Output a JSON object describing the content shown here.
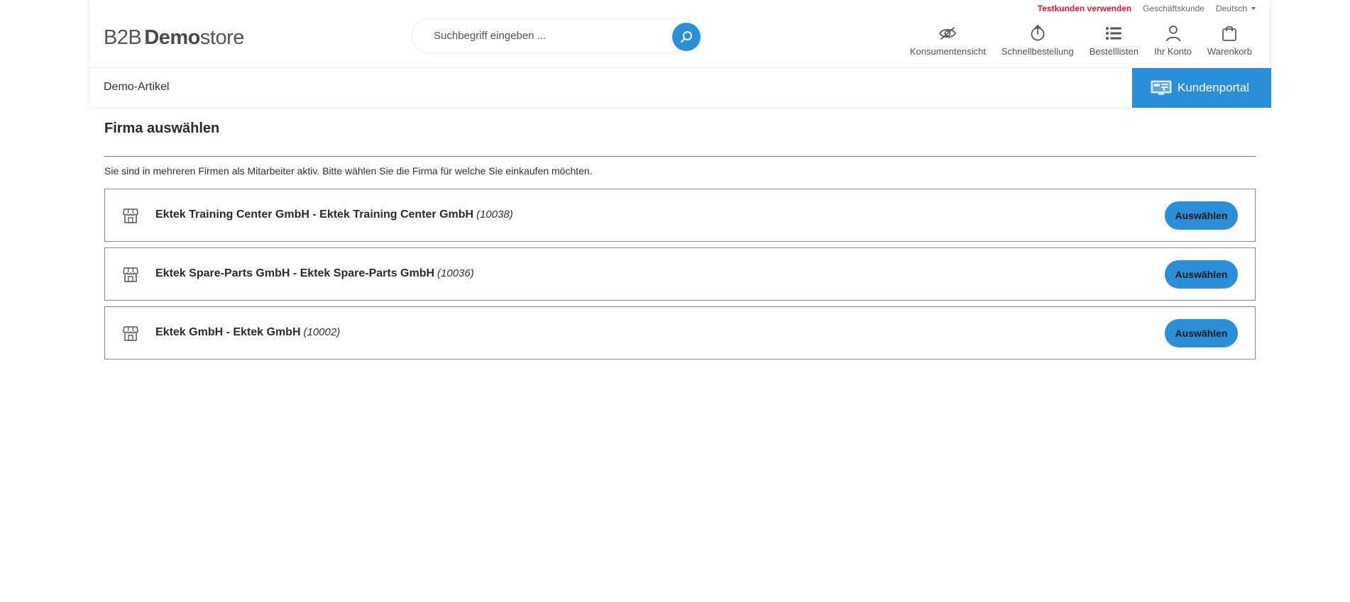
{
  "topbar": {
    "test_customers": "Testkunden verwenden",
    "business_customer": "Geschäftskunde",
    "language": "Deutsch"
  },
  "logo": {
    "b2b": "B2B",
    "demo": "Demo",
    "store": "store"
  },
  "search": {
    "placeholder": "Suchbegriff eingeben ..."
  },
  "actions": [
    {
      "label": "Konsumentensicht",
      "icon": "eye-off-icon"
    },
    {
      "label": "Schnellbestellung",
      "icon": "quick-order-icon"
    },
    {
      "label": "Bestelllisten",
      "icon": "list-icon"
    },
    {
      "label": "Ihr Konto",
      "icon": "user-icon"
    },
    {
      "label": "Warenkorb",
      "icon": "bag-icon"
    }
  ],
  "nav": {
    "demo_articles": "Demo-Artikel",
    "portal": "Kundenportal"
  },
  "content": {
    "title": "Firma auswählen",
    "intro": "Sie sind in mehreren Firmen als Mitarbeiter aktiv. Bitte wählen Sie die Firma für welche Sie einkaufen möchten.",
    "firms": [
      {
        "name": "Ektek Training Center GmbH - Ektek Training Center GmbH",
        "number": "(10038)",
        "button": "Auswählen"
      },
      {
        "name": "Ektek Spare-Parts GmbH - Ektek Spare-Parts GmbH",
        "number": "(10036)",
        "button": "Auswählen"
      },
      {
        "name": "Ektek GmbH - Ektek GmbH",
        "number": "(10002)",
        "button": "Auswählen"
      }
    ]
  },
  "colors": {
    "accent": "#2a8fd6",
    "test_red": "#e3182d"
  }
}
